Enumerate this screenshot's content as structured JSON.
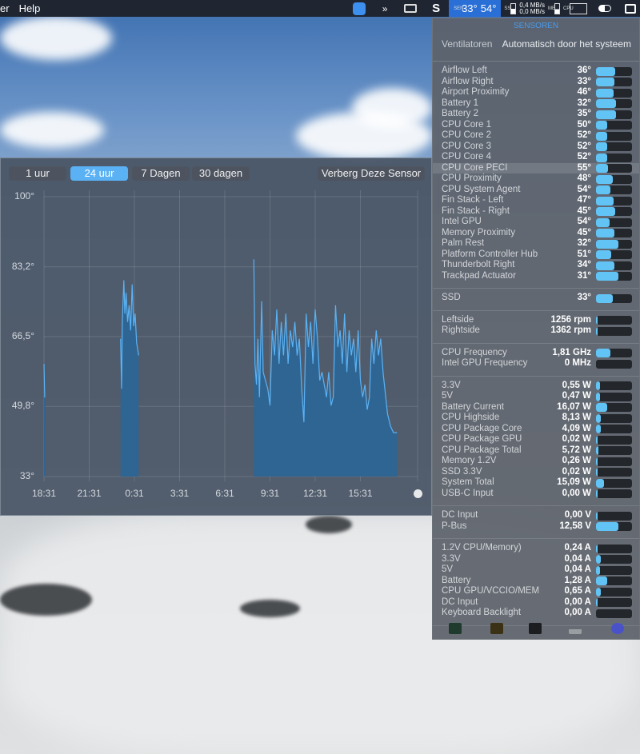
{
  "menubar": {
    "app_fragment": "er",
    "help": "Help",
    "sensor_temp1": "33°",
    "sensor_temp2": "54°",
    "net_up": "0,4 MB/s",
    "net_down": "0,0 MB/s",
    "sen_label": "SEN",
    "ssd_label": "SSD",
    "mem_label": "MEM",
    "cpu_label": "CPU"
  },
  "chart_window": {
    "tabs": [
      {
        "label": "1 uur",
        "active": false
      },
      {
        "label": "24 uur",
        "active": true
      },
      {
        "label": "7 Dagen",
        "active": false
      },
      {
        "label": "30 dagen",
        "active": false
      }
    ],
    "hide_button": "Verberg Deze Sensor"
  },
  "chart_data": {
    "type": "area",
    "title": "",
    "xlabel": "",
    "ylabel": "",
    "ylim": [
      33,
      100
    ],
    "y_ticks": [
      "100°",
      "83,2°",
      "66,5°",
      "49,8°",
      "33°"
    ],
    "y_tick_values": [
      100,
      83.2,
      66.5,
      49.8,
      33
    ],
    "x_ticks": [
      "18:31",
      "21:31",
      "0:31",
      "3:31",
      "6:31",
      "9:31",
      "12:31",
      "15:31"
    ],
    "x_unit": "hours since 18:31",
    "xlim": [
      0,
      24
    ],
    "color": "#5ab2f5",
    "fill": "#2f6592",
    "segments": [
      [
        [
          0,
          60
        ],
        [
          0.05,
          52
        ],
        [
          0.08,
          52
        ]
      ],
      [
        [
          5.08,
          66
        ],
        [
          5.15,
          54
        ],
        [
          5.2,
          70
        ],
        [
          5.3,
          80
        ],
        [
          5.37,
          72
        ],
        [
          5.45,
          77
        ],
        [
          5.55,
          70
        ],
        [
          5.65,
          74
        ],
        [
          5.75,
          68
        ],
        [
          5.85,
          79
        ],
        [
          5.95,
          69
        ],
        [
          6.05,
          72
        ],
        [
          6.15,
          65
        ],
        [
          6.28,
          62
        ]
      ],
      [
        [
          13.93,
          85
        ],
        [
          14.0,
          60
        ],
        [
          14.1,
          55
        ],
        [
          14.2,
          66
        ],
        [
          14.3,
          52
        ],
        [
          14.45,
          75
        ],
        [
          14.55,
          58
        ],
        [
          14.7,
          56
        ],
        [
          14.85,
          54
        ],
        [
          15.0,
          50
        ],
        [
          15.15,
          68
        ],
        [
          15.3,
          62
        ],
        [
          15.45,
          73
        ],
        [
          15.6,
          60
        ],
        [
          15.75,
          70
        ],
        [
          15.9,
          62
        ],
        [
          16.05,
          72
        ],
        [
          16.2,
          60
        ],
        [
          16.35,
          68
        ],
        [
          16.5,
          64
        ],
        [
          16.65,
          70
        ],
        [
          16.8,
          62
        ],
        [
          16.95,
          66
        ],
        [
          17.1,
          54
        ],
        [
          17.25,
          46
        ],
        [
          17.4,
          72
        ],
        [
          17.55,
          64
        ],
        [
          17.7,
          70
        ],
        [
          17.85,
          60
        ],
        [
          18.0,
          73
        ],
        [
          18.15,
          66
        ],
        [
          18.3,
          56
        ],
        [
          18.45,
          58
        ],
        [
          18.6,
          55
        ],
        [
          18.75,
          52
        ],
        [
          18.9,
          58
        ],
        [
          19.05,
          50
        ],
        [
          19.2,
          52
        ],
        [
          19.35,
          74
        ],
        [
          19.5,
          64
        ],
        [
          19.65,
          68
        ],
        [
          19.8,
          60
        ],
        [
          19.95,
          72
        ],
        [
          20.1,
          58
        ],
        [
          20.25,
          68
        ],
        [
          20.4,
          62
        ],
        [
          20.55,
          66
        ],
        [
          20.7,
          58
        ],
        [
          20.85,
          68
        ],
        [
          21.0,
          56
        ],
        [
          21.15,
          52
        ],
        [
          21.3,
          55
        ],
        [
          21.45,
          49
        ],
        [
          21.6,
          52
        ],
        [
          21.75,
          66
        ],
        [
          21.9,
          60
        ],
        [
          22.05,
          68
        ],
        [
          22.2,
          62
        ],
        [
          22.35,
          66
        ],
        [
          22.5,
          58
        ],
        [
          22.65,
          53
        ],
        [
          22.8,
          48
        ],
        [
          23.0,
          45
        ],
        [
          23.2,
          43.5
        ],
        [
          23.43,
          43.5
        ]
      ]
    ]
  },
  "panel": {
    "title": "SENSOREN",
    "fans_label": "Ventilatoren",
    "fans_mode": "Automatisch door het systeem",
    "groups": [
      {
        "rows": [
          {
            "name": "Airflow Left",
            "value": "36°",
            "level": 0.53
          },
          {
            "name": "Airflow Right",
            "value": "33°",
            "level": 0.5
          },
          {
            "name": "Airport Proximity",
            "value": "46°",
            "level": 0.49
          },
          {
            "name": "Battery 1",
            "value": "32°",
            "level": 0.55
          },
          {
            "name": "Battery 2",
            "value": "35°",
            "level": 0.55
          },
          {
            "name": "CPU Core 1",
            "value": "50°",
            "level": 0.3
          },
          {
            "name": "CPU Core 2",
            "value": "52°",
            "level": 0.3
          },
          {
            "name": "CPU Core 3",
            "value": "52°",
            "level": 0.32
          },
          {
            "name": "CPU Core 4",
            "value": "52°",
            "level": 0.3
          },
          {
            "name": "CPU Core PECI",
            "value": "55°",
            "level": 0.33,
            "highlight": true
          },
          {
            "name": "CPU Proximity",
            "value": "48°",
            "level": 0.47
          },
          {
            "name": "CPU System Agent",
            "value": "54°",
            "level": 0.4
          },
          {
            "name": "Fin Stack - Left",
            "value": "47°",
            "level": 0.49
          },
          {
            "name": "Fin Stack - Right",
            "value": "45°",
            "level": 0.53
          },
          {
            "name": "Intel GPU",
            "value": "54°",
            "level": 0.38
          },
          {
            "name": "Memory Proximity",
            "value": "45°",
            "level": 0.5
          },
          {
            "name": "Palm Rest",
            "value": "32°",
            "level": 0.63
          },
          {
            "name": "Platform Controller Hub",
            "value": "51°",
            "level": 0.43
          },
          {
            "name": "Thunderbolt Right",
            "value": "34°",
            "level": 0.5
          },
          {
            "name": "Trackpad Actuator",
            "value": "31°",
            "level": 0.63
          }
        ]
      },
      {
        "rows": [
          {
            "name": "SSD",
            "value": "33°",
            "level": 0.46
          }
        ]
      },
      {
        "rows": [
          {
            "name": "Leftside",
            "value": "1256 rpm",
            "level": 0.02
          },
          {
            "name": "Rightside",
            "value": "1362 rpm",
            "level": 0.02
          }
        ]
      },
      {
        "rows": [
          {
            "name": "CPU Frequency",
            "value": "1,81 GHz",
            "level": 0.4
          },
          {
            "name": "Intel GPU Frequency",
            "value": "0 MHz",
            "level": 0
          }
        ]
      },
      {
        "rows": [
          {
            "name": "3.3V",
            "value": "0,55 W",
            "level": 0.1
          },
          {
            "name": "5V",
            "value": "0,47 W",
            "level": 0.1
          },
          {
            "name": "Battery Current",
            "value": "16,07 W",
            "level": 0.32
          },
          {
            "name": "CPU Highside",
            "value": "8,13 W",
            "level": 0.14
          },
          {
            "name": "CPU Package Core",
            "value": "4,09 W",
            "level": 0.13
          },
          {
            "name": "CPU Package GPU",
            "value": "0,02 W",
            "level": 0.02
          },
          {
            "name": "CPU Package Total",
            "value": "5,72 W",
            "level": 0.07
          },
          {
            "name": "Memory 1.2V",
            "value": "0,26 W",
            "level": 0.04
          },
          {
            "name": "SSD 3.3V",
            "value": "0,02 W",
            "level": 0.02
          },
          {
            "name": "System Total",
            "value": "15,09 W",
            "level": 0.22
          },
          {
            "name": "USB-C Input",
            "value": "0,00 W",
            "level": 0.02
          }
        ]
      },
      {
        "rows": [
          {
            "name": "DC Input",
            "value": "0,00 V",
            "level": 0.02
          },
          {
            "name": "P-Bus",
            "value": "12,58 V",
            "level": 0.63
          }
        ]
      },
      {
        "rows": [
          {
            "name": "1.2V CPU/Memory)",
            "value": "0,24 A",
            "level": 0.04
          },
          {
            "name": "3.3V",
            "value": "0,04 A",
            "level": 0.14
          },
          {
            "name": "5V",
            "value": "0,04 A",
            "level": 0.12
          },
          {
            "name": "Battery",
            "value": "1,28 A",
            "level": 0.3
          },
          {
            "name": "CPU GPU/VCCIO/MEM",
            "value": "0,65 A",
            "level": 0.14
          },
          {
            "name": "DC Input",
            "value": "0,00 A",
            "level": 0.02
          },
          {
            "name": "Keyboard Backlight",
            "value": "0,00 A",
            "level": 0
          }
        ]
      }
    ],
    "footer_icons": [
      "activity-monitor-icon",
      "console-log-icon",
      "terminal-icon",
      "eject-icon",
      "istat-icon"
    ]
  }
}
